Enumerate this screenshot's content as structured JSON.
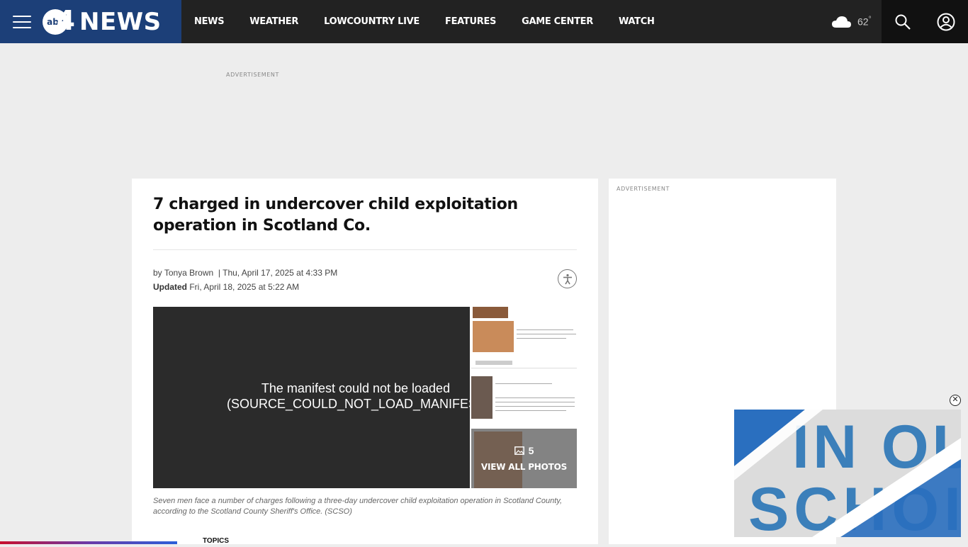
{
  "header": {
    "logo_abc": "abc",
    "logo_number": "4",
    "logo_text": "NEWS",
    "nav": [
      "NEWS",
      "WEATHER",
      "LOWCOUNTRY LIVE",
      "FEATURES",
      "GAME CENTER",
      "WATCH"
    ],
    "weather_temp": "62",
    "weather_unit": "°",
    "colors": {
      "brand": "#1c3f78",
      "bar": "#222222"
    }
  },
  "top_ad": {
    "label": "ADVERTISEMENT"
  },
  "article": {
    "headline": "7 charged in undercover child exploitation operation in Scotland Co.",
    "byline_prefix": "by",
    "author": "Tonya Brown",
    "published": "Thu, April 17, 2025 at 4:33 PM",
    "updated_label": "Updated",
    "updated": "Fri, April 18, 2025 at 5:22 AM",
    "player_error_line1": "The manifest could not be loaded",
    "player_error_line2": "(SOURCE_COULD_NOT_LOAD_MANIFEST",
    "gallery_count": "5",
    "gallery_label": "VIEW ALL PHOTOS",
    "caption": "Seven men face a number of charges following a three-day undercover child exploitation operation in Scotland County, according to the Scotland County Sheriff's Office. (SCSO)",
    "topics_label": "TOPICS"
  },
  "sidebar": {
    "ad_label": "ADVERTISEMENT"
  },
  "floating_video": {
    "text_line1": "IN OU",
    "text_line2": "SCHOI",
    "close_symbol": "✕"
  }
}
